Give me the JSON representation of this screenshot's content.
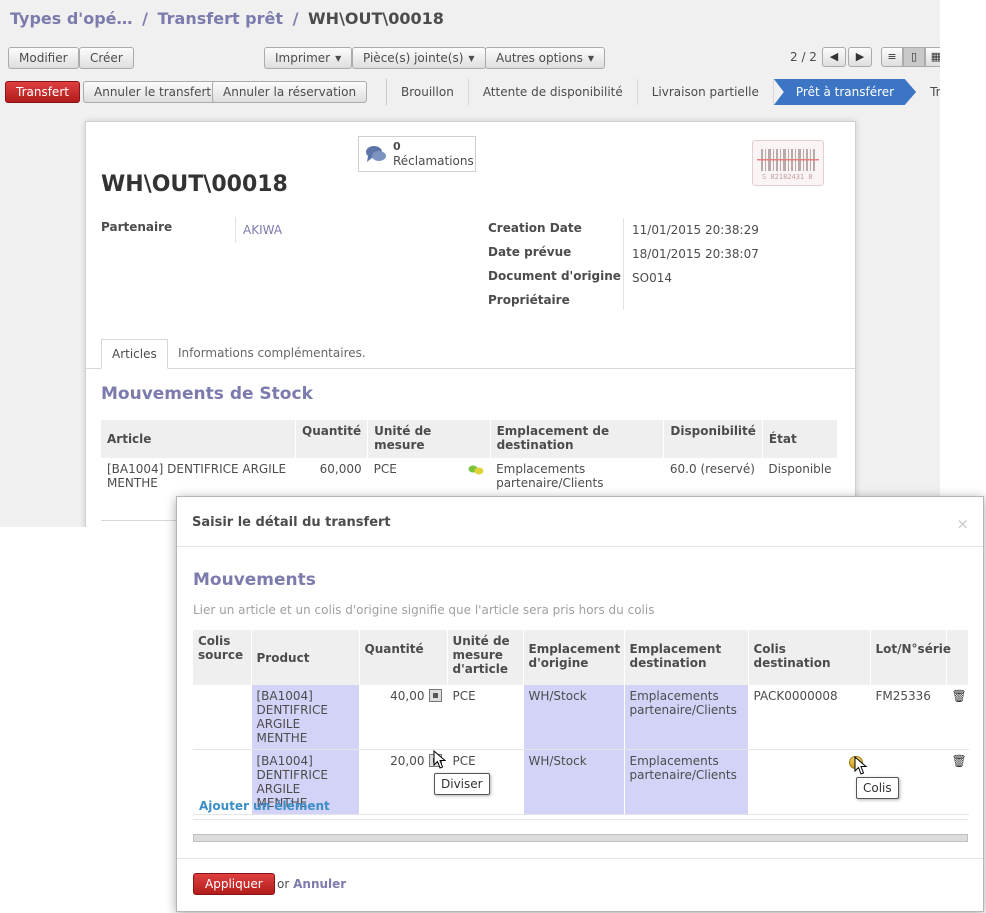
{
  "breadcrumb": {
    "parent1": "Types d'opé…",
    "sep1": "/",
    "parent2": "Transfert prêt",
    "sep2": "/",
    "current": "WH\\OUT\\00018"
  },
  "toolbar": {
    "edit": "Modifier",
    "create": "Créer",
    "print": "Imprimer",
    "attachments": "Pièce(s) jointe(s)",
    "more": "Autres options",
    "pager": "2 / 2",
    "prev_icon": "arrow-left-icon",
    "next_icon": "arrow-right-icon"
  },
  "statusbar": {
    "transfer": "Transfert",
    "cancel_transfer": "Annuler le transfert",
    "cancel_reservation": "Annuler la réservation",
    "stages": [
      "Brouillon",
      "Attente de disponibilité",
      "Livraison partielle",
      "Prêt à transférer",
      "Transféré"
    ],
    "active_stage": "Prêt à transférer"
  },
  "sheet": {
    "claims_count": "0",
    "claims_label": "Réclamations",
    "barcode_text": "S 82182431 8",
    "title": "WH\\OUT\\00018",
    "fields": {
      "partner_label": "Partenaire",
      "partner_value": "AKIWA",
      "creation_date_label": "Creation Date",
      "creation_date_value": "11/01/2015 20:38:29",
      "scheduled_date_label": "Date prévue",
      "scheduled_date_value": "18/01/2015 20:38:07",
      "origin_label": "Document d'origine",
      "origin_value": "SO014",
      "owner_label": "Propriétaire",
      "owner_value": ""
    },
    "tabs": [
      "Articles",
      "Informations complémentaires."
    ],
    "section_title": "Mouvements de Stock",
    "table": {
      "headers": {
        "article": "Article",
        "quantity": "Quantité",
        "uom_1": "Unité de",
        "uom_2": "mesure",
        "dest": "Emplacement de destination",
        "availability": "Disponibilité",
        "state": "État"
      },
      "row": {
        "article_1": "[BA1004] DENTIFRICE ARGILE",
        "article_2": "MENTHE",
        "quantity": "60,000",
        "uom": "PCE",
        "dest_1": "Emplacements",
        "dest_2": "partenaire/Clients",
        "availability": "60.0 (reservé)",
        "state": "Disponible"
      }
    }
  },
  "modal": {
    "title": "Saisir le détail du transfert",
    "close": "×",
    "section_title": "Mouvements",
    "help": "Lier un article et un colis d'origine signifie que l'article sera pris hors du colis",
    "headers": {
      "src_pack_1": "Colis",
      "src_pack_2": "source",
      "product": "Product",
      "quantity": "Quantité",
      "uom_1": "Unité de",
      "uom_2": "mesure",
      "uom_3": "d'article",
      "src_loc_1": "Emplacement",
      "src_loc_2": "d'origine",
      "dest_loc_1": "Emplacement",
      "dest_loc_2": "destination",
      "dest_pack_1": "Colis",
      "dest_pack_2": "destination",
      "lot": "Lot/N°série"
    },
    "rows": [
      {
        "product_1": "[BA1004]",
        "product_2": "DENTIFRICE",
        "product_3": "ARGILE MENTHE",
        "quantity": "40,00",
        "uom": "PCE",
        "src": "WH/Stock",
        "dest_1": "Emplacements",
        "dest_2": "partenaire/Clients",
        "pack": "PACK0000008",
        "lot": "FM25336"
      },
      {
        "product_1": "[BA1004]",
        "product_2": "DENTIFRICE",
        "product_3": "ARGILE MENTHE",
        "quantity": "20,00",
        "uom": "PCE",
        "src": "WH/Stock",
        "dest_1": "Emplacements",
        "dest_2": "partenaire/Clients",
        "pack": "",
        "lot": ""
      }
    ],
    "add_item": "Ajouter un élément",
    "apply": "Appliquer",
    "or": "or",
    "cancel": "Annuler",
    "tooltip_split": "Diviser",
    "tooltip_pack": "Colis"
  },
  "colors": {
    "accent": "#7c7bad",
    "primary_button": "#c02a2a",
    "active_stage": "#3b75c4",
    "highlight_cell": "#d3d3f7",
    "link_blue": "#3b8ec6"
  }
}
